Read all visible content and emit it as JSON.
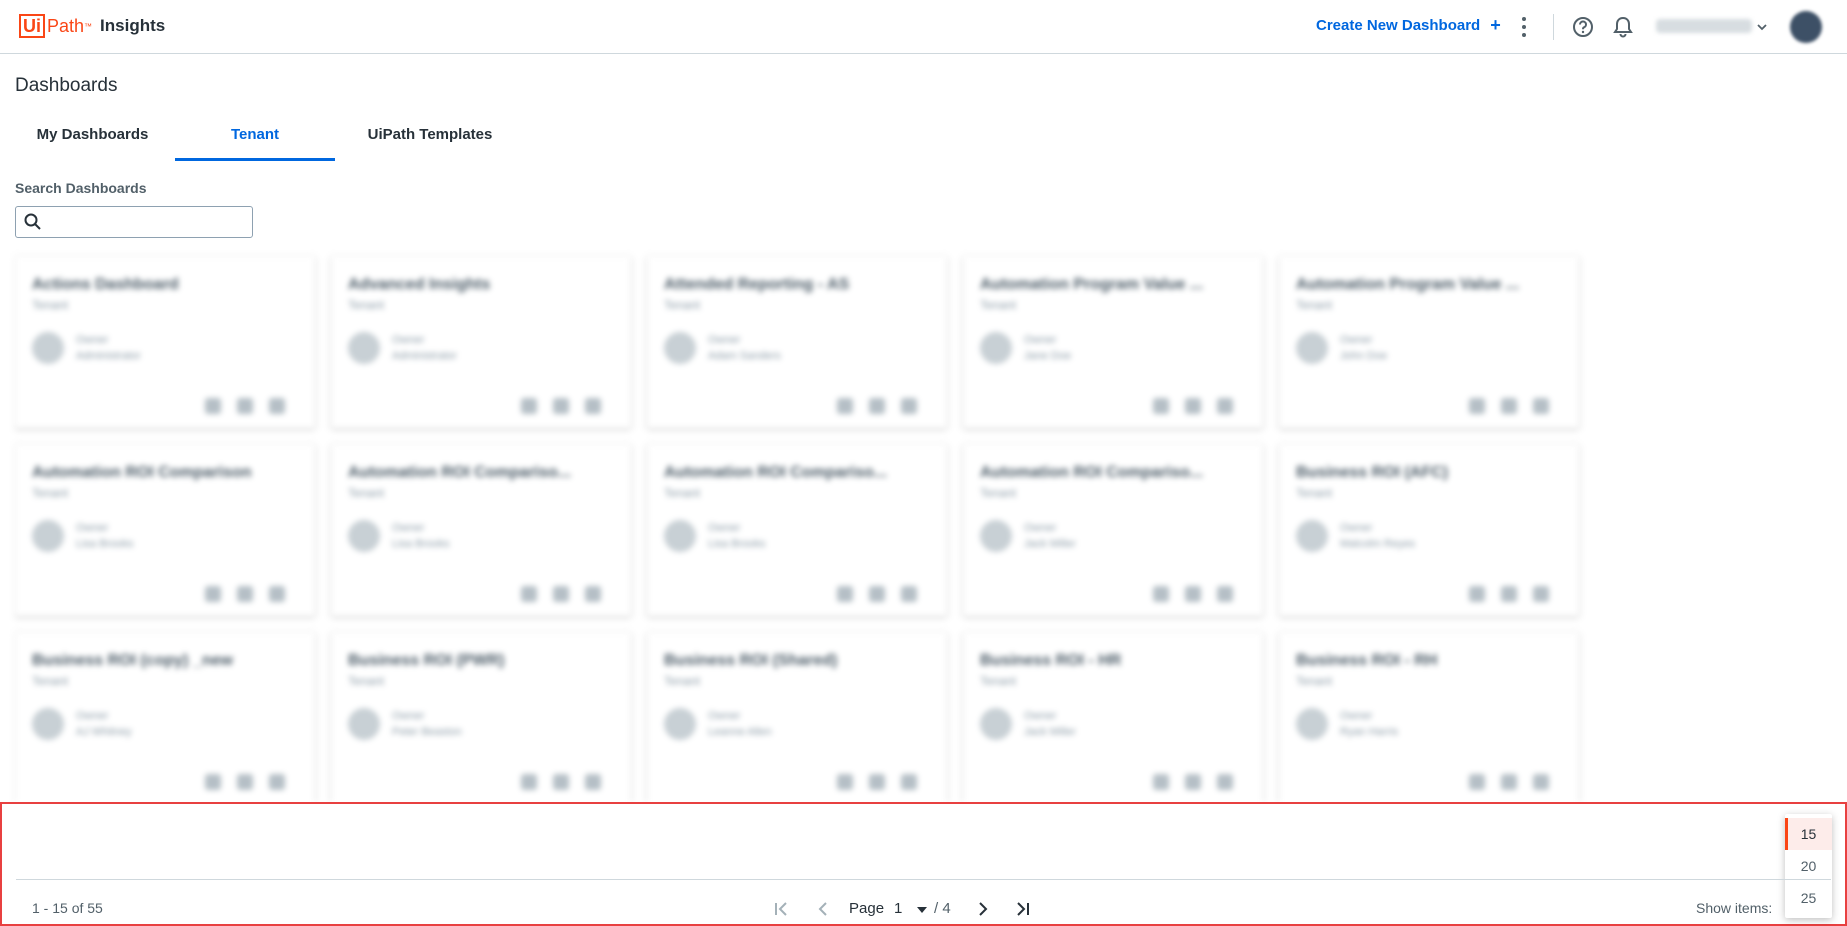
{
  "header": {
    "logo_brand_box": "Ui",
    "logo_brand_rest": "Path",
    "logo_tm": "™",
    "product": "Insights",
    "create_button": "Create New Dashboard",
    "create_plus": "+"
  },
  "page": {
    "title": "Dashboards",
    "tabs": [
      {
        "label": "My Dashboards",
        "active": false
      },
      {
        "label": "Tenant",
        "active": true
      },
      {
        "label": "UiPath Templates",
        "active": false
      }
    ],
    "search": {
      "label": "Search Dashboards",
      "value": "",
      "placeholder": ""
    }
  },
  "cards": [
    {
      "title": "Actions Dashboard",
      "sub": "Tenant",
      "owner_label": "Owner",
      "owner": "Administrator"
    },
    {
      "title": "Advanced Insights",
      "sub": "Tenant",
      "owner_label": "Owner",
      "owner": "Administrator"
    },
    {
      "title": "Attended Reporting - AS",
      "sub": "Tenant",
      "owner_label": "Owner",
      "owner": "Adam Sanders"
    },
    {
      "title": "Automation Program Value ...",
      "sub": "Tenant",
      "owner_label": "Owner",
      "owner": "Jane Doe"
    },
    {
      "title": "Automation Program Value ...",
      "sub": "Tenant",
      "owner_label": "Owner",
      "owner": "John Doe"
    },
    {
      "title": "Automation ROI Comparison",
      "sub": "Tenant",
      "owner_label": "Owner",
      "owner": "Lisa Brooks"
    },
    {
      "title": "Automation ROI Compariso...",
      "sub": "Tenant",
      "owner_label": "Owner",
      "owner": "Lisa Brooks"
    },
    {
      "title": "Automation ROI Compariso...",
      "sub": "Tenant",
      "owner_label": "Owner",
      "owner": "Lisa Brooks"
    },
    {
      "title": "Automation ROI Compariso...",
      "sub": "Tenant",
      "owner_label": "Owner",
      "owner": "Jack Miller"
    },
    {
      "title": "Business ROI (AFC)",
      "sub": "Tenant",
      "owner_label": "Owner",
      "owner": "Malcolm Reyes"
    },
    {
      "title": "Business ROI (copy) _new",
      "sub": "Tenant",
      "owner_label": "Owner",
      "owner": "AJ Whitney"
    },
    {
      "title": "Business ROI (PWR)",
      "sub": "Tenant",
      "owner_label": "Owner",
      "owner": "Peter Beaston"
    },
    {
      "title": "Business ROI (Shared)",
      "sub": "Tenant",
      "owner_label": "Owner",
      "owner": "Leanne Allen"
    },
    {
      "title": "Business ROI - HR",
      "sub": "Tenant",
      "owner_label": "Owner",
      "owner": "Jack Miller"
    },
    {
      "title": "Business ROI - RH",
      "sub": "Tenant",
      "owner_label": "Owner",
      "owner": "Ryan Harris"
    }
  ],
  "pager": {
    "range": "1 - 15 of 55",
    "page_label": "Page",
    "current_page": "1",
    "total_pages": "/ 4",
    "show_items_label": "Show items:",
    "page_size_options": [
      "15",
      "20",
      "25"
    ],
    "selected_page_size": "15"
  },
  "colors": {
    "accent": "#0067df",
    "brand": "#fa4616",
    "highlight_border": "#e84040"
  }
}
